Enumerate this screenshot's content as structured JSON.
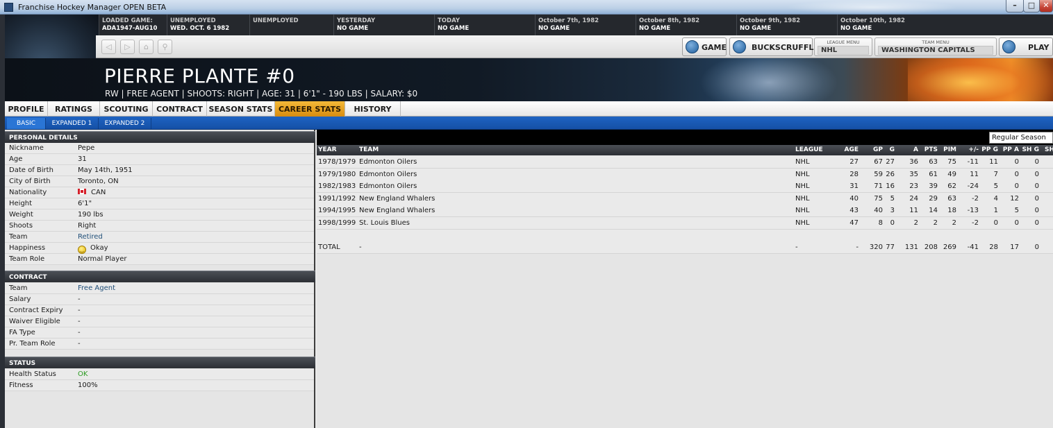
{
  "window": {
    "title": "Franchise Hockey Manager OPEN BETA",
    "minimize_glyph": "–",
    "maximize_glyph": "□",
    "close_glyph": "✕"
  },
  "schedule": [
    {
      "line1": "LOADED GAME:",
      "line2": "ADA1947-AUG10"
    },
    {
      "line1": "UNEMPLOYED",
      "line2": "WED. OCT. 6 1982"
    },
    {
      "line1": "UNEMPLOYED",
      "line2": ""
    },
    {
      "line1": "YESTERDAY",
      "line2": "NO GAME"
    },
    {
      "line1": "TODAY",
      "line2": "NO GAME"
    },
    {
      "line1": "October 7th, 1982",
      "line2": "NO GAME"
    },
    {
      "line1": "October 8th, 1982",
      "line2": "NO GAME"
    },
    {
      "line1": "October 9th, 1982",
      "line2": "NO GAME"
    },
    {
      "line1": "October 10th, 1982",
      "line2": "NO GAME"
    }
  ],
  "nav": {
    "back_glyph": "◁",
    "forward_glyph": "▷",
    "home_glyph": "⌂",
    "search_glyph": "⚲",
    "game_label": "GAME",
    "manager_label": "BUCKSCRUFFLE",
    "league_menu_caption": "LEAGUE MENU",
    "league_menu_value": "NHL",
    "team_menu_caption": "TEAM MENU",
    "team_menu_value": "WASHINGTON CAPITALS",
    "play_label": "PLAY"
  },
  "player": {
    "name": "PIERRE PLANTE #0",
    "subtitle": "RW | FREE AGENT | SHOOTS: RIGHT | AGE: 31 | 6'1\" - 190 LBS | SALARY: $0"
  },
  "tabs": [
    "PROFILE",
    "RATINGS",
    "SCOUTING",
    "CONTRACT",
    "SEASON STATS",
    "CAREER STATS",
    "HISTORY"
  ],
  "active_tab": "CAREER STATS",
  "subtabs": [
    "BASIC",
    "EXPANDED 1",
    "EXPANDED 2"
  ],
  "active_subtab": "BASIC",
  "personal": {
    "heading": "PERSONAL DETAILS",
    "rows": [
      {
        "k": "Nickname",
        "v": "Pepe"
      },
      {
        "k": "Age",
        "v": "31"
      },
      {
        "k": "Date of Birth",
        "v": "May 14th, 1951"
      },
      {
        "k": "City of Birth",
        "v": "Toronto, ON"
      },
      {
        "k": "Nationality",
        "v": "CAN"
      },
      {
        "k": "Height",
        "v": "6'1\""
      },
      {
        "k": "Weight",
        "v": "190 lbs"
      },
      {
        "k": "Shoots",
        "v": "Right"
      },
      {
        "k": "Team",
        "v": "Retired"
      },
      {
        "k": "Happiness",
        "v": "Okay"
      },
      {
        "k": "Team Role",
        "v": "Normal Player"
      }
    ]
  },
  "contract": {
    "heading": "CONTRACT",
    "rows": [
      {
        "k": "Team",
        "v": "Free Agent"
      },
      {
        "k": "Salary",
        "v": "-"
      },
      {
        "k": "Contract Expiry",
        "v": "-"
      },
      {
        "k": "Waiver Eligible",
        "v": "-"
      },
      {
        "k": "FA Type",
        "v": "-"
      },
      {
        "k": "Pr. Team Role",
        "v": "-"
      }
    ]
  },
  "status": {
    "heading": "STATUS",
    "rows": [
      {
        "k": "Health Status",
        "v": "OK"
      },
      {
        "k": "Fitness",
        "v": "100%"
      }
    ]
  },
  "stats": {
    "season_select": "Regular Season",
    "columns": [
      "YEAR",
      "TEAM",
      "LEAGUE",
      "AGE",
      "GP",
      "G",
      "A",
      "PTS",
      "PIM",
      "+/-",
      "PP G",
      "PP A",
      "SH G",
      "SH"
    ],
    "rows": [
      [
        "1978/1979",
        "Edmonton Oilers",
        "NHL",
        "27",
        "67",
        "27",
        "36",
        "63",
        "75",
        "-11",
        "11",
        "0",
        "0"
      ],
      [
        "1979/1980",
        "Edmonton Oilers",
        "NHL",
        "28",
        "59",
        "26",
        "35",
        "61",
        "49",
        "11",
        "7",
        "0",
        "0"
      ],
      [
        "1982/1983",
        "Edmonton Oilers",
        "NHL",
        "31",
        "71",
        "16",
        "23",
        "39",
        "62",
        "-24",
        "5",
        "0",
        "0"
      ],
      [
        "1991/1992",
        "New England Whalers",
        "NHL",
        "40",
        "75",
        "5",
        "24",
        "29",
        "63",
        "-2",
        "4",
        "12",
        "0"
      ],
      [
        "1994/1995",
        "New England Whalers",
        "NHL",
        "43",
        "40",
        "3",
        "11",
        "14",
        "18",
        "-13",
        "1",
        "5",
        "0"
      ],
      [
        "1998/1999",
        "St. Louis Blues",
        "NHL",
        "47",
        "8",
        "0",
        "2",
        "2",
        "2",
        "-2",
        "0",
        "0",
        "0"
      ]
    ],
    "total": [
      "TOTAL",
      "-",
      "-",
      "-",
      "320",
      "77",
      "131",
      "208",
      "269",
      "-41",
      "28",
      "17",
      "0"
    ]
  }
}
